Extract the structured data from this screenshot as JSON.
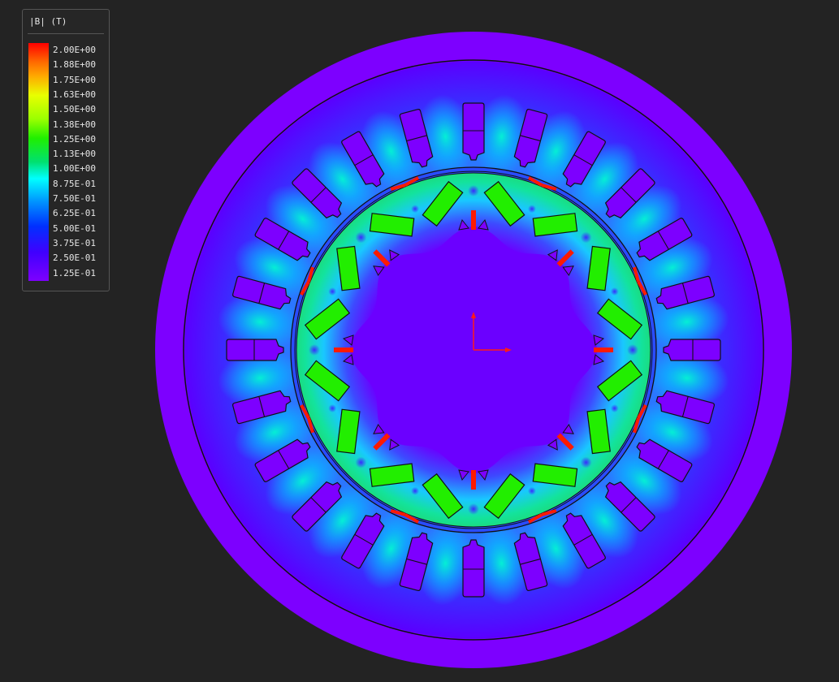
{
  "legend": {
    "title": "|B| (T)",
    "labels": [
      "2.00E+00",
      "1.88E+00",
      "1.75E+00",
      "1.63E+00",
      "1.50E+00",
      "1.38E+00",
      "1.25E+00",
      "1.13E+00",
      "1.00E+00",
      "8.75E-01",
      "7.50E-01",
      "6.25E-01",
      "5.00E-01",
      "3.75E-01",
      "2.50E-01",
      "1.25E-01"
    ],
    "colors": [
      "#ff0000",
      "#ff7700",
      "#ffaa00",
      "#ffff00",
      "#b5ff00",
      "#55ff00",
      "#22ee00",
      "#00dd44",
      "#00e8a0",
      "#00ffff",
      "#00c8ff",
      "#0080ff",
      "#0040ff",
      "#1a10ff",
      "#5a00ff",
      "#7d00ff"
    ]
  },
  "model": {
    "stator_slots": 24,
    "rotor_poles": 8,
    "stator_yoke_color": "#7a00ff",
    "rotor_core_color": "#6b00ff",
    "magnet_color": "#22ee00"
  }
}
